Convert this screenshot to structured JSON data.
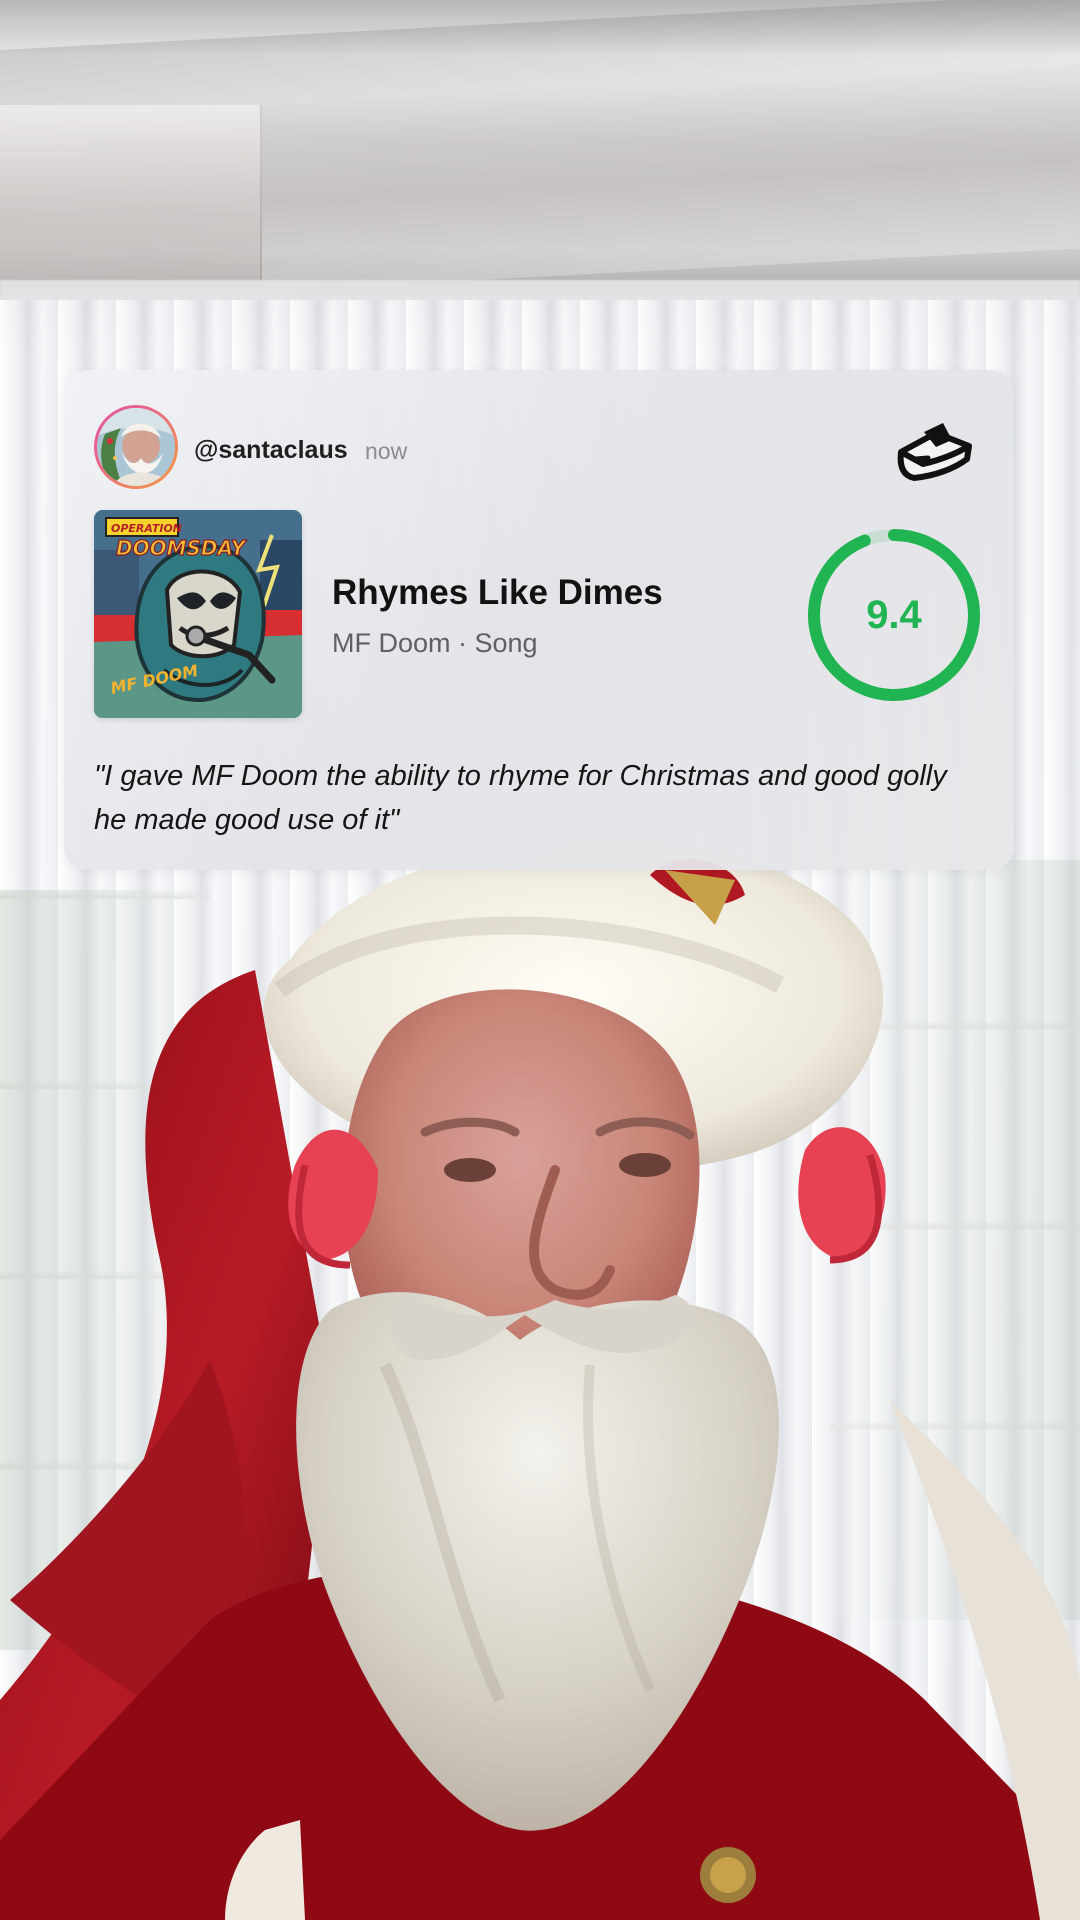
{
  "post": {
    "username": "@santaclaus",
    "time": "now"
  },
  "song": {
    "title": "Rhymes Like Dimes",
    "meta": "MF Doom · Song",
    "album_text_top": "OPERATION",
    "album_text_main": "DOOMSDAY",
    "album_text_logo": "MF DOOM"
  },
  "rating": {
    "score": "9.4",
    "fraction": 0.94,
    "color": "#20b452"
  },
  "review": {
    "quote": "\"I gave MF Doom the ability to rhyme for Christmas and good golly he made good use of it\""
  },
  "icons": {
    "avatar": "santa-avatar",
    "top_right": "inbox-icon"
  }
}
